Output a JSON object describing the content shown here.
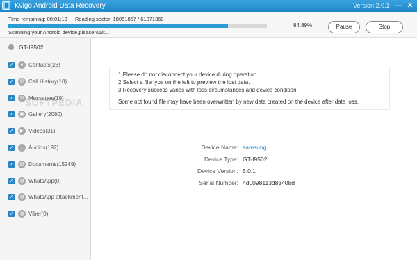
{
  "window": {
    "title": "Kvigo Android Data Recovery",
    "version": "Version:2.0.1",
    "minimize": "—",
    "close": "✕"
  },
  "progress": {
    "time_remaining": "Time remaining: 00:01:18",
    "reading_sector": "Reading sector: 18051857 / 61071360",
    "percent_text": "84.89%",
    "fraction": 0.8489,
    "status": "Scanning your Android device,please wait..."
  },
  "buttons": {
    "pause": "Pause",
    "stop": "Stop"
  },
  "device": {
    "name": "GT-I9502"
  },
  "categories": [
    {
      "label": "Contacts(28)",
      "icon": "person-icon",
      "glyph": "●"
    },
    {
      "label": "Call History(10)",
      "icon": "phone-icon",
      "glyph": "✆"
    },
    {
      "label": "Messages(19)",
      "icon": "message-icon",
      "glyph": "✉"
    },
    {
      "label": "Gallery(2080)",
      "icon": "image-icon",
      "glyph": "▣"
    },
    {
      "label": "Videos(31)",
      "icon": "video-icon",
      "glyph": "▶"
    },
    {
      "label": "Audios(197)",
      "icon": "audio-icon",
      "glyph": "♪"
    },
    {
      "label": "Documents(15249)",
      "icon": "document-icon",
      "glyph": "▤"
    },
    {
      "label": "WhatsApp(0)",
      "icon": "whatsapp-icon",
      "glyph": "◍"
    },
    {
      "label": "WhatsApp attachment...",
      "icon": "whatsapp-attachment-icon",
      "glyph": "◍"
    },
    {
      "label": "Viber(0)",
      "icon": "viber-icon",
      "glyph": "◍"
    }
  ],
  "watermark": "SOFTPEDIA",
  "notice": {
    "line1": "1.Please do not disconnect your device during operation.",
    "line2": "2.Select a file type on the left to preview the lost data.",
    "line3": "3.Recovery success varies with loss circumstances and device condition.",
    "line4": "Some not found file may have been overwritten by new data created on the device after data loss."
  },
  "device_info": {
    "name_label": "Device Name:",
    "name_value": "samsung",
    "type_label": "Device Type:",
    "type_value": "GT-I9502",
    "version_label": "Device Version:",
    "version_value": "5.0.1",
    "serial_label": "Serial Number:",
    "serial_value": "4d0098113d83408d"
  },
  "colors": {
    "accent": "#2b86c5",
    "titlebar": "#1e86c7",
    "progress": "#2b9bd8"
  }
}
